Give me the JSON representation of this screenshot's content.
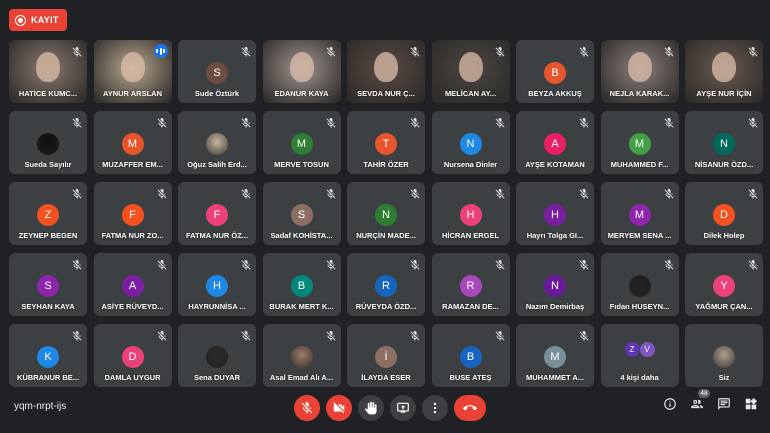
{
  "recording": {
    "label": "KAYIT",
    "color": "#ea4335"
  },
  "meeting_code": "yqm-nrpt-ijs",
  "participant_count": "48",
  "participants": [
    {
      "name": "HATİCE KUMC...",
      "video": true,
      "bg": "#8a7a70"
    },
    {
      "name": "AYNUR ARSLAN",
      "video": true,
      "bg": "#b8a890",
      "speaking": true
    },
    {
      "name": "Sude Öztürk",
      "initial": "S",
      "color": "#6d4c41"
    },
    {
      "name": "EDANUR KAYA",
      "video": true,
      "bg": "#a09590"
    },
    {
      "name": "SEVDA NUR Ç...",
      "video": true,
      "bg": "#5a4a45"
    },
    {
      "name": "MELİCAN AY...",
      "video": true,
      "bg": "#4a4540"
    },
    {
      "name": "BEYZA AKKUŞ",
      "initial": "B",
      "color": "#e8542c"
    },
    {
      "name": "NEJLA KARAK...",
      "video": true,
      "bg": "#8a7f7a"
    },
    {
      "name": "AYŞE NUR İÇİN",
      "video": true,
      "bg": "#6a5a50"
    },
    {
      "name": "Sueda Sayılır",
      "photo": true,
      "color": "#111111"
    },
    {
      "name": "MUZAFFER EM...",
      "initial": "M",
      "color": "#e8542c"
    },
    {
      "name": "Oğuz Salih Erd...",
      "photo": true,
      "color": "#c7b7a0"
    },
    {
      "name": "MERVE TOSUN",
      "initial": "M",
      "color": "#2e7d32"
    },
    {
      "name": "TAHİR ÖZER",
      "initial": "T",
      "color": "#e8542c"
    },
    {
      "name": "Nursena Dinler",
      "initial": "N",
      "color": "#1e88e5"
    },
    {
      "name": "AYŞE KOTAMAN",
      "initial": "A",
      "color": "#e91e63"
    },
    {
      "name": "MUHAMMED F...",
      "initial": "M",
      "color": "#43a047"
    },
    {
      "name": "NİSANUR ÖZD...",
      "initial": "N",
      "color": "#00695c"
    },
    {
      "name": "ZEYNEP BEGEN",
      "initial": "Z",
      "color": "#f4511e"
    },
    {
      "name": "FATMA NUR ZO...",
      "initial": "F",
      "color": "#f4511e"
    },
    {
      "name": "FATMA NUR ÖZ...",
      "initial": "F",
      "color": "#ec407a"
    },
    {
      "name": "Sadaf KOHİSTA...",
      "initial": "S",
      "color": "#8d6e63"
    },
    {
      "name": "NURÇİN MADE...",
      "initial": "N",
      "color": "#2e7d32"
    },
    {
      "name": "HİCRAN ERGEL",
      "initial": "H",
      "color": "#ec407a"
    },
    {
      "name": "Hayrı Tolga GI...",
      "initial": "H",
      "color": "#7b1fa2"
    },
    {
      "name": "MERYEM SENA ...",
      "initial": "M",
      "color": "#8e24aa"
    },
    {
      "name": "Dilek Holep",
      "initial": "D",
      "color": "#f4511e"
    },
    {
      "name": "SEYHAN KAYA",
      "initial": "S",
      "color": "#8e24aa"
    },
    {
      "name": "ASİYE RÜVEYD...",
      "initial": "A",
      "color": "#7b1fa2"
    },
    {
      "name": "HAYRUNNİSA ...",
      "initial": "H",
      "color": "#1e88e5"
    },
    {
      "name": "BURAK MERT K...",
      "initial": "B",
      "color": "#00897b"
    },
    {
      "name": "RÜVEYDA ÖZD...",
      "initial": "R",
      "color": "#1565c0"
    },
    {
      "name": "RAMAZAN DE...",
      "initial": "R",
      "color": "#ab47bc"
    },
    {
      "name": "Nazım Demirbaş",
      "initial": "N",
      "color": "#6a1b9a"
    },
    {
      "name": "Fıdan HUSEYN...",
      "photo": true,
      "color": "#222222"
    },
    {
      "name": "YAĞMUR ÇAN...",
      "initial": "Y",
      "color": "#ec407a"
    },
    {
      "name": "KÜBRANUR BE...",
      "initial": "K",
      "color": "#1e88e5"
    },
    {
      "name": "DAMLA UYGUR",
      "initial": "D",
      "color": "#ec407a"
    },
    {
      "name": "Sena DUYAR",
      "photo": true,
      "color": "#2a2a2a"
    },
    {
      "name": "Asal Emad Alı A...",
      "photo": true,
      "color": "#9e7b6a"
    },
    {
      "name": "İLAYDA ESER",
      "initial": "İ",
      "color": "#8d6e63"
    },
    {
      "name": "BUSE ATEŞ",
      "initial": "B",
      "color": "#1565c0"
    },
    {
      "name": "MUHAMMET A...",
      "initial": "M",
      "color": "#78909c"
    },
    {
      "name": "4 kişi daha",
      "others": true,
      "minis": [
        {
          "initial": "Z",
          "color": "#5e35b1"
        },
        {
          "initial": "V",
          "color": "#7e57c2"
        }
      ]
    },
    {
      "name": "Siz",
      "photo": true,
      "color": "#b0a090",
      "self": true
    }
  ],
  "controls": [
    {
      "name": "mic-off-icon",
      "red": true
    },
    {
      "name": "camera-off-icon",
      "red": true
    },
    {
      "name": "raise-hand-icon"
    },
    {
      "name": "present-screen-icon"
    },
    {
      "name": "more-options-icon"
    },
    {
      "name": "leave-call-icon",
      "red": true,
      "hang": true
    }
  ],
  "right_icons": [
    "info-icon",
    "people-icon",
    "chat-icon",
    "activities-icon"
  ]
}
